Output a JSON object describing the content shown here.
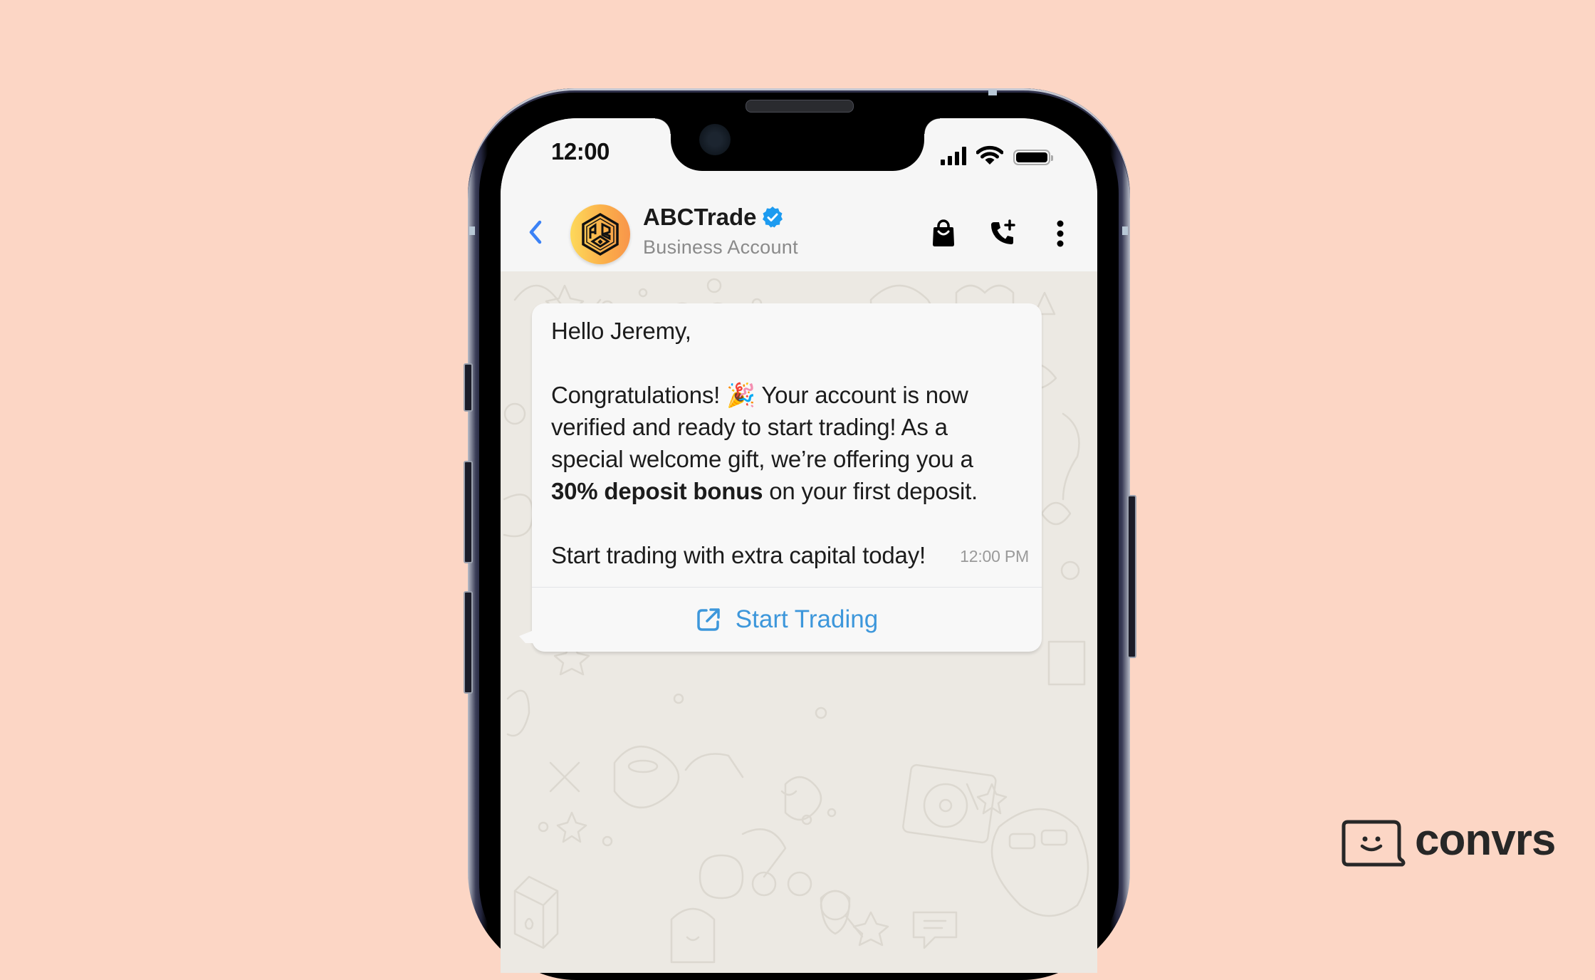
{
  "status_bar": {
    "time": "12:00",
    "icons": [
      "cellular-signal-icon",
      "wifi-icon",
      "battery-icon"
    ]
  },
  "chat_header": {
    "back_icon": "chevron-left-icon",
    "contact_name": "ABCTrade",
    "verified": true,
    "subtitle": "Business Account",
    "actions": [
      "shopping-bag-icon",
      "add-call-icon",
      "more-vertical-icon"
    ]
  },
  "message": {
    "greeting": "Hello Jeremy,",
    "paragraph_1_start": "Congratulations!",
    "emoji": "🎉",
    "paragraph_1_rest": "Your account is now verified and ready to start trading! As a special welcome gift, we’re offering you a",
    "bold_offer": "30% deposit bonus",
    "paragraph_1_end": "on your first deposit.",
    "paragraph_2": "Start trading with extra capital today!",
    "timestamp": "12:00 PM",
    "cta": {
      "label": "Start Trading",
      "icon": "external-link-icon"
    }
  },
  "colors": {
    "background": "#fcd6c5",
    "header_bg": "#f6f6f6",
    "chat_bg": "#ece9e3",
    "bubble_bg": "#f8f8f8",
    "cta_blue": "#3d97db",
    "back_blue": "#3b82f6",
    "verified_blue": "#1d9bf0"
  },
  "brand": {
    "name": "convrs",
    "logo_icon": "smiley-chat-icon"
  }
}
